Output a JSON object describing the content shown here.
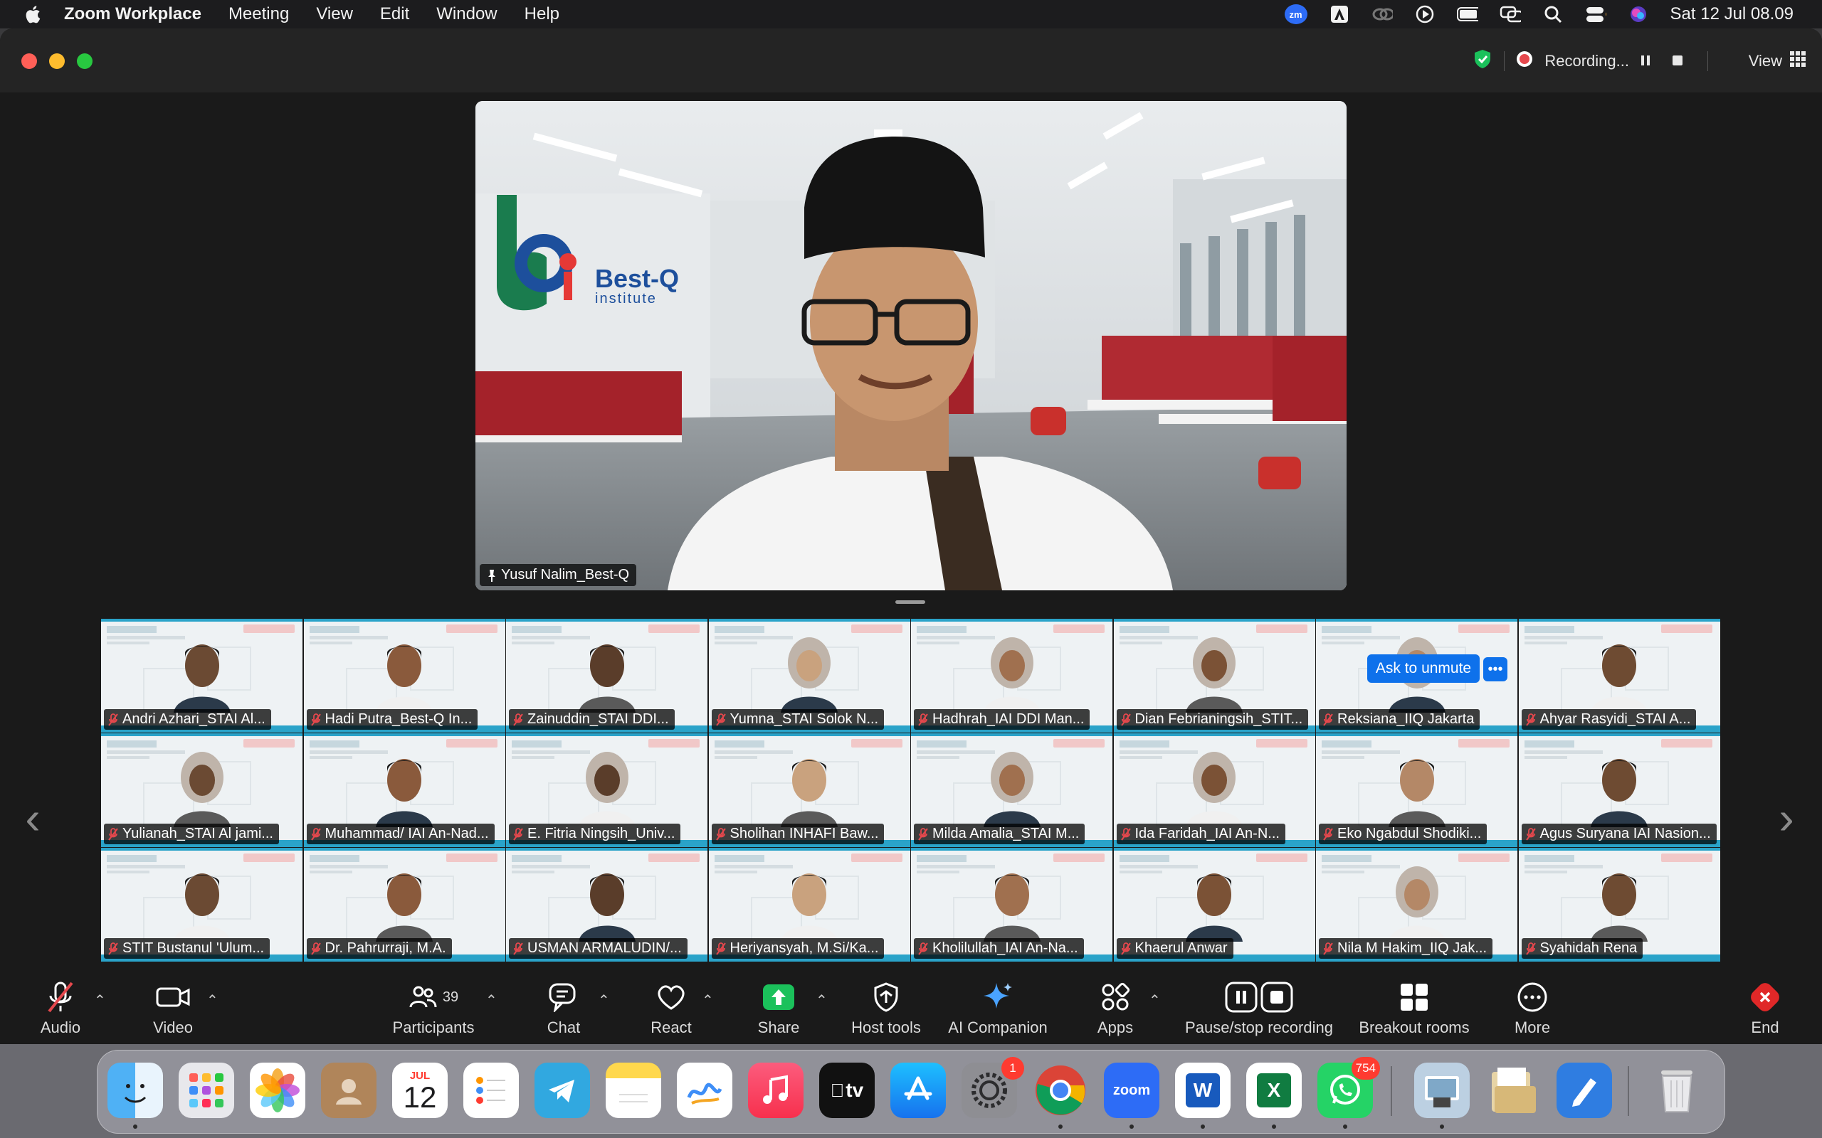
{
  "menubar": {
    "app_name": "Zoom Workplace",
    "menus": [
      "Meeting",
      "View",
      "Edit",
      "Window",
      "Help"
    ],
    "zoom_badge": "zm",
    "clock": "Sat 12 Jul  08.09"
  },
  "titlebar": {
    "recording_label": "Recording...",
    "view_label": "View"
  },
  "main_video": {
    "speaker_name": "Yusuf Nalim_Best-Q",
    "brand_name": "Best-Q",
    "brand_sub": "institute"
  },
  "gallery": {
    "tiles": [
      {
        "name": "Andri Azhari_STAI Al..."
      },
      {
        "name": "Hadi Putra_Best-Q In..."
      },
      {
        "name": "Zainuddin_STAI DDI..."
      },
      {
        "name": "Yumna_STAI Solok N..."
      },
      {
        "name": "Hadhrah_IAI DDI Man..."
      },
      {
        "name": "Dian Febrianingsih_STIT..."
      },
      {
        "name": "Reksiana_IIQ Jakarta"
      },
      {
        "name": "Ahyar Rasyidi_STAI A..."
      },
      {
        "name": "Yulianah_STAI Al jami..."
      },
      {
        "name": "Muhammad/ IAI An-Nad..."
      },
      {
        "name": "E. Fitria Ningsih_Univ..."
      },
      {
        "name": "Sholihan INHAFI Baw..."
      },
      {
        "name": "Milda Amalia_STAI M..."
      },
      {
        "name": "Ida Faridah_IAI An-N..."
      },
      {
        "name": "Eko Ngabdul Shodiki..."
      },
      {
        "name": "Agus Suryana IAI Nasion..."
      },
      {
        "name": "STIT Bustanul 'Ulum..."
      },
      {
        "name": "Dr. Pahrurraji, M.A."
      },
      {
        "name": "USMAN ARMALUDIN/..."
      },
      {
        "name": "Heriyansyah, M.Si/Ka..."
      },
      {
        "name": "Kholilullah_IAI An-Na..."
      },
      {
        "name": "Khaerul Anwar"
      },
      {
        "name": "Nila M Hakim_IIQ Jak..."
      },
      {
        "name": "Syahidah Rena"
      }
    ],
    "ask_to_unmute": "Ask to unmute",
    "more_dots": "•••"
  },
  "toolbar": {
    "audio": "Audio",
    "video": "Video",
    "participants": "Participants",
    "participants_count": "39",
    "chat": "Chat",
    "react": "React",
    "share": "Share",
    "host_tools": "Host tools",
    "ai_companion": "AI Companion",
    "apps": "Apps",
    "pause_stop": "Pause/stop recording",
    "breakout": "Breakout rooms",
    "more": "More",
    "end": "End"
  },
  "dock": {
    "calendar_month": "JUL",
    "calendar_day": "12",
    "appletv_label": "tv",
    "zoom_label": "zoom",
    "word_label": "W",
    "excel_label": "X",
    "settings_badge": "1",
    "whatsapp_badge": "754"
  },
  "colors": {
    "accent_blue": "#0e71eb",
    "share_green": "#1bc15b",
    "end_red": "#e02828",
    "recording_red": "#e5484d",
    "shield_green": "#1bc15b"
  }
}
